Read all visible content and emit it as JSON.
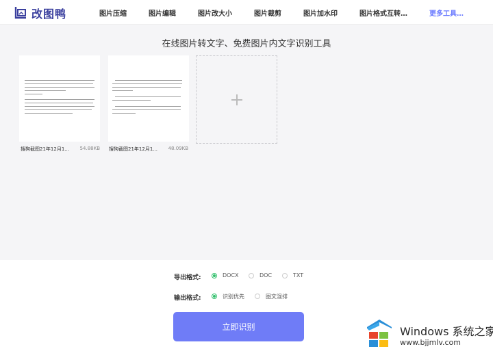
{
  "header": {
    "logo_text": "改图鸭",
    "nav": [
      {
        "label": "图片压缩"
      },
      {
        "label": "图片编辑"
      },
      {
        "label": "图片改大小"
      },
      {
        "label": "图片裁剪"
      },
      {
        "label": "图片加水印"
      },
      {
        "label": "图片格式互转…"
      },
      {
        "label": "更多工具…"
      }
    ]
  },
  "main": {
    "title": "在线图片转文字、免费图片内文字识别工具",
    "files": [
      {
        "name": "搜狗截图21年12月1...",
        "size": "54.88KB"
      },
      {
        "name": "搜狗截图21年12月1...",
        "size": "48.09KB"
      }
    ],
    "add_icon": "plus-icon"
  },
  "options": {
    "export_label": "导出格式:",
    "export_formats": [
      {
        "label": "DOCX",
        "checked": true
      },
      {
        "label": "DOC",
        "checked": false
      },
      {
        "label": "TXT",
        "checked": false
      }
    ],
    "output_label": "输出格式:",
    "output_modes": [
      {
        "label": "识别优先",
        "checked": true
      },
      {
        "label": "图文混排",
        "checked": false
      }
    ],
    "submit_label": "立即识别"
  },
  "watermark": {
    "brand": "Windows 系统之家",
    "url": "www.bjjmlv.com"
  },
  "colors": {
    "accent": "#6f7cf7",
    "radio_checked": "#2fbf6a",
    "logo": "#3a3f9e"
  }
}
